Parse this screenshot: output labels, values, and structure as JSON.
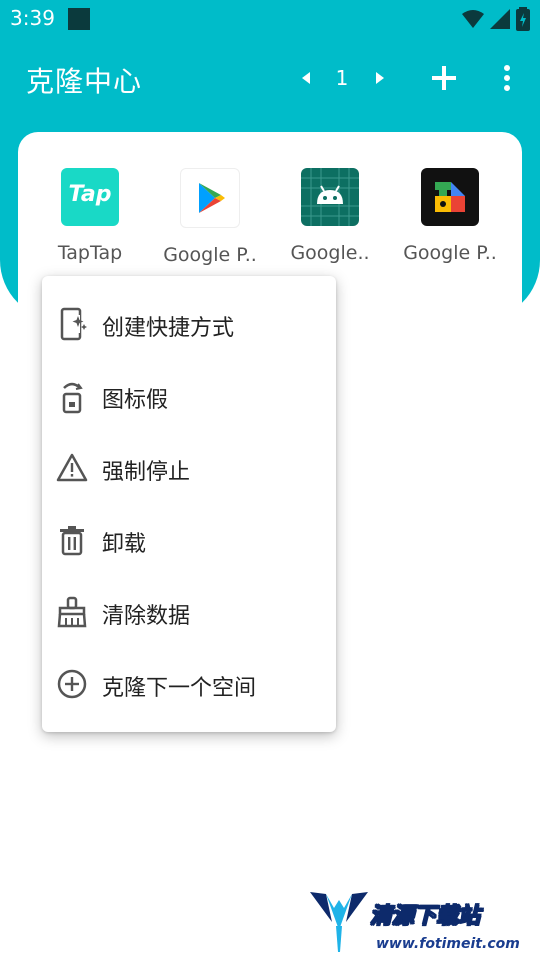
{
  "status_bar": {
    "time": "3:39",
    "background": "#00bcc9"
  },
  "app_bar": {
    "title": "克隆中心",
    "page_number": "1",
    "accent": "#00bcc9"
  },
  "apps": [
    {
      "label": "TapTap",
      "icon": "taptap-icon",
      "icon_text": "Tap"
    },
    {
      "label": "Google P..",
      "icon": "google-play-store-icon"
    },
    {
      "label": "Google..",
      "icon": "android-system-icon"
    },
    {
      "label": "Google P..",
      "icon": "google-play-services-icon"
    }
  ],
  "menu": {
    "items": [
      {
        "label": "创建快捷方式",
        "icon": "create-shortcut-icon"
      },
      {
        "label": "图标假",
        "icon": "fake-icon-icon"
      },
      {
        "label": "强制停止",
        "icon": "warning-triangle-icon"
      },
      {
        "label": "卸载",
        "icon": "trash-icon"
      },
      {
        "label": "清除数据",
        "icon": "broom-icon"
      },
      {
        "label": "克隆下一个空间",
        "icon": "add-circle-icon"
      }
    ]
  },
  "watermark": {
    "title": "清源下载站",
    "url": "www.fotimeit.com"
  }
}
